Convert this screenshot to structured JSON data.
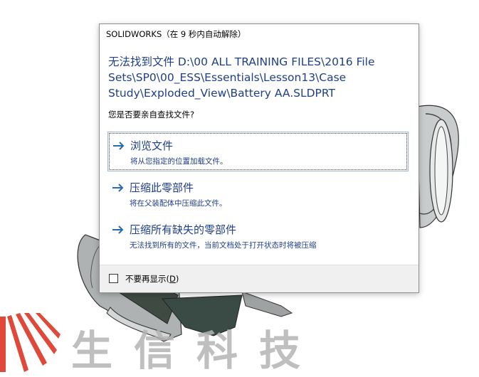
{
  "dialog": {
    "title": "SOLIDWORKS（在 9 秒内自动解除）",
    "main_instruction": "无法找到文件 D:\\00 ALL TRAINING FILES\\2016 File Sets\\SP0\\00_ESS\\Essentials\\Lesson13\\Case Study\\Exploded_View\\Battery AA.SLDPRT",
    "content": "您是否要亲自查找文件?",
    "commands": [
      {
        "title": "浏览文件",
        "desc": "将从您指定的位置加载文件。"
      },
      {
        "title": "压缩此零部件",
        "desc": "将在父装配体中压缩此文件。"
      },
      {
        "title": "压缩所有缺失的零部件",
        "desc": "无法找到所有的文件，当前文档处于打开状态时将被压缩"
      }
    ],
    "footer": {
      "checkbox_label": "不要再显示(",
      "accelerator": "D",
      "checkbox_label_end": ")",
      "checked": false
    }
  },
  "watermark": {
    "text": "生信科技"
  },
  "colors": {
    "accent": "#1f3f8a",
    "arrow": "#2a6ab5",
    "logo_red": "#e0493a"
  }
}
